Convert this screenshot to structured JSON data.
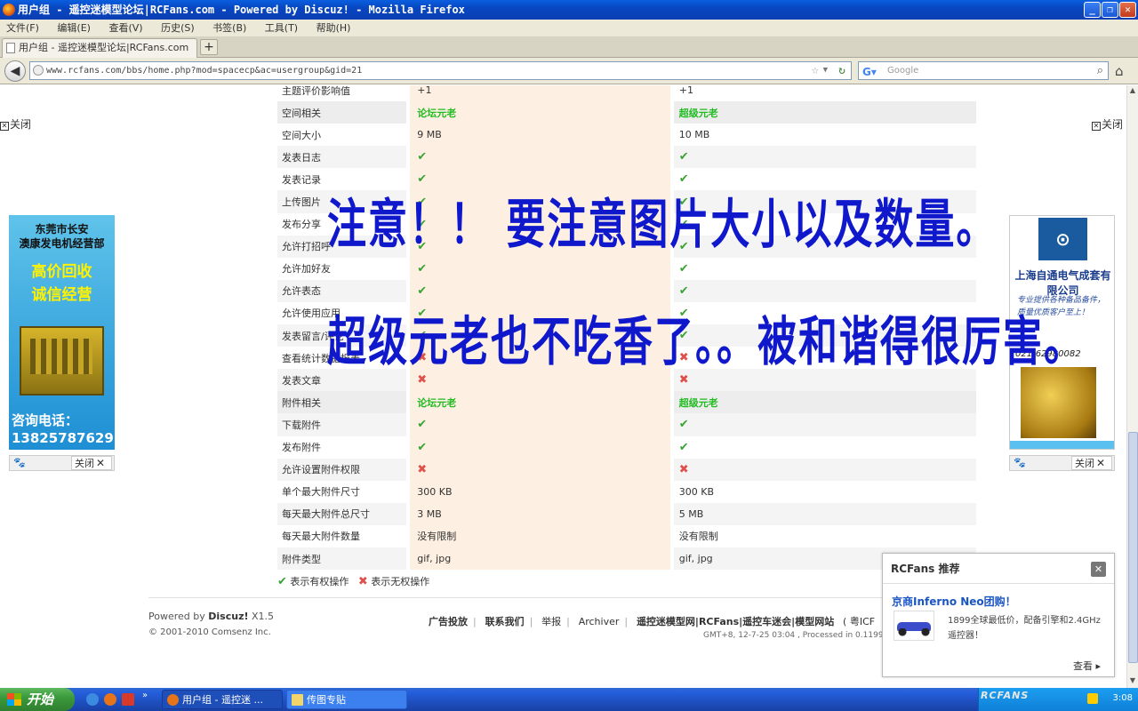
{
  "window": {
    "title": "用户组 - 遥控迷模型论坛|RCFans.com - Powered by Discuz! - Mozilla Firefox",
    "controls": [
      "_",
      "❐",
      "✕"
    ]
  },
  "menu": [
    "文件(F)",
    "编辑(E)",
    "查看(V)",
    "历史(S)",
    "书签(B)",
    "工具(T)",
    "帮助(H)"
  ],
  "tab": {
    "label": "用户组 - 遥控迷模型论坛|RCFans.com",
    "new_tab": "+"
  },
  "nav": {
    "url": "www.rcfans.com/bbs/home.php?mod=spacecp&ac=usergroup&gid=21",
    "search_placeholder": "Google"
  },
  "table": {
    "rows": [
      {
        "label": "主题评价影响值",
        "c1": "+1",
        "c2": "+1",
        "type": "text"
      },
      {
        "label": "空间相关",
        "c1": "论坛元老",
        "c2": "超级元老",
        "type": "section"
      },
      {
        "label": "空间大小",
        "c1": "9 MB",
        "c2": "10 MB",
        "type": "text"
      },
      {
        "label": "发表日志",
        "c1": "✔",
        "c2": "✔",
        "type": "yes"
      },
      {
        "label": "发表记录",
        "c1": "✔",
        "c2": "✔",
        "type": "yes"
      },
      {
        "label": "上传图片",
        "c1": "✔",
        "c2": "✔",
        "type": "yes"
      },
      {
        "label": "发布分享",
        "c1": "✔",
        "c2": "✔",
        "type": "yes"
      },
      {
        "label": "允许打招呼",
        "c1": "✔",
        "c2": "✔",
        "type": "yes"
      },
      {
        "label": "允许加好友",
        "c1": "✔",
        "c2": "✔",
        "type": "yes"
      },
      {
        "label": "允许表态",
        "c1": "✔",
        "c2": "✔",
        "type": "yes"
      },
      {
        "label": "允许使用应用",
        "c1": "✔",
        "c2": "✔",
        "type": "yes"
      },
      {
        "label": "发表留言/评论",
        "c1": "✔",
        "c2": "✔",
        "type": "yes"
      },
      {
        "label": "查看统计数据报表",
        "c1": "✖",
        "c2": "✖",
        "type": "no"
      },
      {
        "label": "发表文章",
        "c1": "✖",
        "c2": "✖",
        "type": "no"
      },
      {
        "label": "附件相关",
        "c1": "论坛元老",
        "c2": "超级元老",
        "type": "section"
      },
      {
        "label": "下载附件",
        "c1": "✔",
        "c2": "✔",
        "type": "yes"
      },
      {
        "label": "发布附件",
        "c1": "✔",
        "c2": "✔",
        "type": "yes"
      },
      {
        "label": "允许设置附件权限",
        "c1": "✖",
        "c2": "✖",
        "type": "no"
      },
      {
        "label": "单个最大附件尺寸",
        "c1": "300 KB",
        "c2": "300 KB",
        "type": "text"
      },
      {
        "label": "每天最大附件总尺寸",
        "c1": "3 MB",
        "c2": "5 MB",
        "type": "text"
      },
      {
        "label": "每天最大附件数量",
        "c1": "没有限制",
        "c2": "没有限制",
        "type": "text"
      },
      {
        "label": "附件类型",
        "c1": "gif, jpg",
        "c2": "gif, jpg",
        "type": "text"
      }
    ]
  },
  "legend": {
    "yes_icon": "✔",
    "yes": "表示有权操作",
    "no_icon": "✖",
    "no": "表示无权操作"
  },
  "overlay": {
    "line1": "注意！！ 要注意图片大小以及数量。",
    "line2": "超级元老也不吃香了。。被和谐得很厉害。"
  },
  "footer": {
    "powered_prefix": "Powered by ",
    "powered_brand": "Discuz!",
    "powered_version": " X1.5",
    "copyright": "© 2001-2010 Comsenz Inc.",
    "links": [
      "广告投放",
      "联系我们",
      "举报",
      "Archiver",
      "遥控迷模型网|RCFans|遥控车迷会|模型网站",
      "( 粤ICF"
    ],
    "gmt": "GMT+8, 12-7-25 03:04 , Processed in 0.11992"
  },
  "ads": {
    "close_label": "关闭",
    "left": {
      "line1": "东莞市长安",
      "line2": "澳康发电机经营部",
      "line3": "高价回收",
      "line4": "诚信经营",
      "line5": "咨询电话：",
      "line6": "13825787629"
    },
    "right": {
      "company": "上海自通电气成套有限公司",
      "desc": "专业提供各种备品备件，质量优质客户至上！",
      "phone": "021-62980082"
    }
  },
  "popup": {
    "header": "RCFans 推荐",
    "title": "京商Inferno Neo团购！",
    "desc": "1899全球最低价，配备引擎和2.4GHz遥控器！",
    "more": "查看 ▸"
  },
  "taskbar": {
    "start": "开始",
    "tasks": [
      "用户组 - 遥控迷 ...",
      "传图专贴"
    ],
    "tray_logo": "RCFANS",
    "clock": "3:08"
  }
}
